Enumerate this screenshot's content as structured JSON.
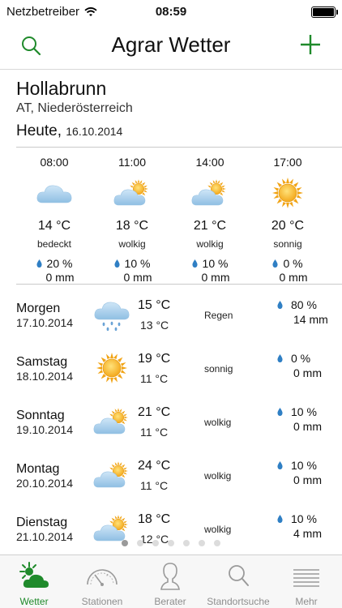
{
  "status_bar": {
    "carrier": "Netzbetreiber",
    "time": "08:59"
  },
  "nav": {
    "title": "Agrar Wetter",
    "search_icon": "search-icon",
    "add_icon": "plus-icon",
    "accent_color": "#1f8a2b"
  },
  "location": {
    "name": "Hollabrunn",
    "region": "AT, Niederösterreich"
  },
  "today": {
    "label": "Heute,",
    "date": "16.10.2014"
  },
  "hourly": [
    {
      "time": "08:00",
      "icon": "cloud-icon",
      "temp": "14 °C",
      "condition": "bedeckt",
      "precip": "20 %",
      "amount": "0 mm"
    },
    {
      "time": "11:00",
      "icon": "sun-cloud-icon",
      "temp": "18 °C",
      "condition": "wolkig",
      "precip": "10 %",
      "amount": "0 mm"
    },
    {
      "time": "14:00",
      "icon": "sun-cloud-icon",
      "temp": "21 °C",
      "condition": "wolkig",
      "precip": "10 %",
      "amount": "0 mm"
    },
    {
      "time": "17:00",
      "icon": "sun-icon",
      "temp": "20 °C",
      "condition": "sonnig",
      "precip": "0 %",
      "amount": "0 mm"
    }
  ],
  "daily": [
    {
      "day": "Morgen",
      "date": "17.10.2014",
      "icon": "rain-cloud-icon",
      "max": "15 °C",
      "min": "13 °C",
      "condition": "Regen",
      "precip": "80 %",
      "amount": "14 mm"
    },
    {
      "day": "Samstag",
      "date": "18.10.2014",
      "icon": "sun-icon",
      "max": "19 °C",
      "min": "11 °C",
      "condition": "sonnig",
      "precip": "0 %",
      "amount": "0 mm"
    },
    {
      "day": "Sonntag",
      "date": "19.10.2014",
      "icon": "sun-cloud-icon",
      "max": "21 °C",
      "min": "11 °C",
      "condition": "wolkig",
      "precip": "10 %",
      "amount": "0 mm"
    },
    {
      "day": "Montag",
      "date": "20.10.2014",
      "icon": "sun-cloud-icon",
      "max": "24 °C",
      "min": "11 °C",
      "condition": "wolkig",
      "precip": "10 %",
      "amount": "0 mm"
    },
    {
      "day": "Dienstag",
      "date": "21.10.2014",
      "icon": "sun-cloud-icon",
      "max": "18 °C",
      "min": "12 °C",
      "condition": "wolkig",
      "precip": "10 %",
      "amount": "4 mm"
    }
  ],
  "pager": {
    "count": 7,
    "active": 0
  },
  "tabs": [
    {
      "label": "Wetter",
      "icon": "weather-icon",
      "active": true
    },
    {
      "label": "Stationen",
      "icon": "gauge-icon",
      "active": false
    },
    {
      "label": "Berater",
      "icon": "person-icon",
      "active": false
    },
    {
      "label": "Standortsuche",
      "icon": "search-icon",
      "active": false
    },
    {
      "label": "Mehr",
      "icon": "menu-icon",
      "active": false
    }
  ]
}
